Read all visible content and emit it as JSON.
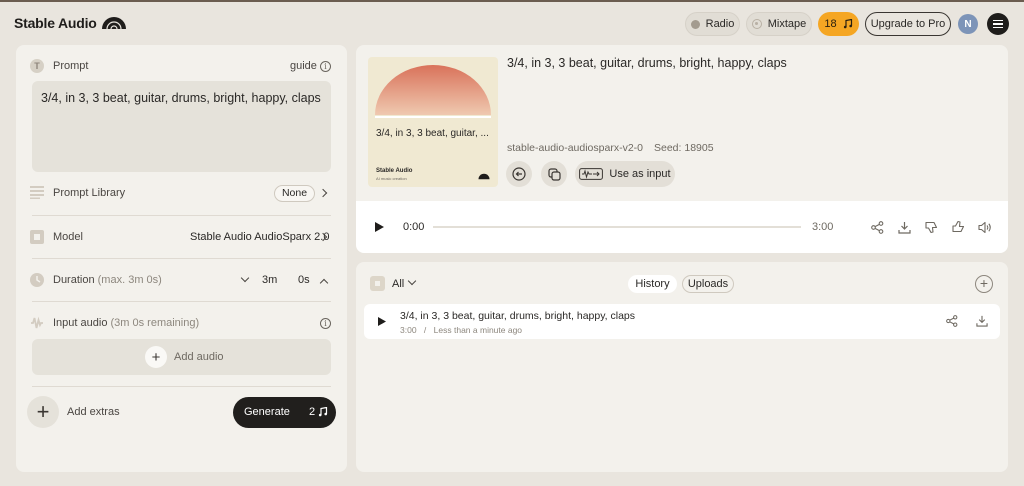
{
  "app": {
    "name": "Stable Audio"
  },
  "header": {
    "radio_label": "Radio",
    "mixtape_label": "Mixtape",
    "credits": "18",
    "upgrade_label": "Upgrade to Pro",
    "avatar_initial": "N"
  },
  "left": {
    "prompt_label": "Prompt",
    "guide_label": "guide",
    "prompt_text": "3/4, in 3, 3 beat, guitar, drums, bright, happy, claps",
    "prompt_library_label": "Prompt Library",
    "prompt_library_value": "None",
    "model_label": "Model",
    "model_value": "Stable Audio AudioSparx 2.0",
    "duration_label": "Duration",
    "duration_hint": "(max. 3m 0s)",
    "duration_minutes": "3m",
    "duration_seconds": "0s",
    "input_audio_label": "Input audio",
    "input_audio_hint": "(3m 0s remaining)",
    "add_audio_label": "Add audio",
    "add_extras_label": "Add extras",
    "generate_label": "Generate",
    "generate_cost": "2"
  },
  "track": {
    "title": "3/4, in 3, 3 beat, guitar, drums, bright, happy, claps",
    "cover_caption": "3/4, in 3, 3 beat, guitar, ...",
    "cover_brand": "Stable Audio",
    "cover_tagline": "AI music creation",
    "model_id": "stable-audio-audiosparx-v2-0",
    "seed_label": "Seed: 18905",
    "use_as_input_label": "Use as input",
    "current_time": "0:00",
    "duration": "3:00",
    "progress": 0
  },
  "history": {
    "filter_label": "All",
    "tabs": [
      {
        "label": "History",
        "active": true
      },
      {
        "label": "Uploads",
        "active": false
      }
    ],
    "items": [
      {
        "title": "3/4, in 3, 3 beat, guitar, drums, bright, happy, claps",
        "duration": "3:00",
        "separator": "/",
        "age": "Less than a minute ago"
      }
    ]
  },
  "colors": {
    "background": "#e9e5de",
    "panel": "#f3f1ec",
    "credits_accent": "#f5a623",
    "cover_gradient_top": "#d9725a",
    "cover_gradient_bottom": "#efc9b0",
    "dark": "#211f1d"
  }
}
